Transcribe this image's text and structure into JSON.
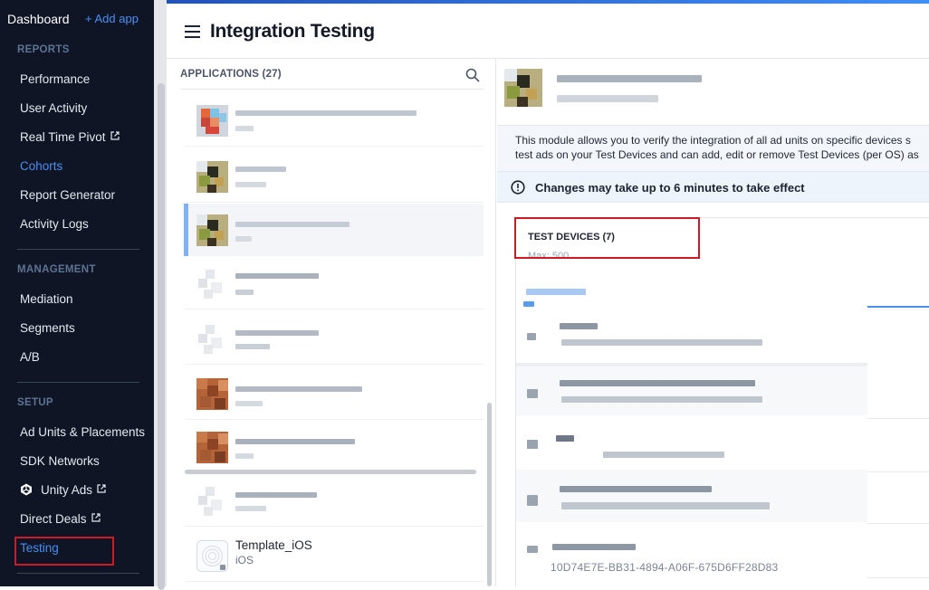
{
  "sidebar": {
    "dashboard_label": "Dashboard",
    "add_app_label": "+ Add app",
    "sections": {
      "reports": "REPORTS",
      "management": "MANAGEMENT",
      "setup": "SETUP"
    },
    "reports_items": [
      "Performance",
      "User Activity",
      "Real Time Pivot",
      "Cohorts",
      "Report Generator",
      "Activity Logs"
    ],
    "management_items": [
      "Mediation",
      "Segments",
      "A/B"
    ],
    "setup_items": [
      "Ad Units & Placements",
      "SDK Networks",
      "Unity Ads",
      "Direct Deals",
      "Testing"
    ],
    "active_item": "Cohorts",
    "selected_item": "Testing"
  },
  "header": {
    "title": "Integration Testing"
  },
  "applications": {
    "heading": "APPLICATIONS (27)",
    "last_app": {
      "name": "Template_iOS",
      "platform": "iOS"
    }
  },
  "detail": {
    "info_text": "This module allows you to verify the integration of all ad units on specific devices s test ads on your Test Devices and can add, edit or remove Test Devices (per OS) as",
    "info_line1": "This module allows you to verify the integration of all ad units on specific devices s",
    "info_line2": "test ads on your Test Devices and can add, edit or remove Test Devices (per OS) as",
    "warning": "Changes may take up to 6 minutes to take effect",
    "test_devices_title": "TEST DEVICES (7)",
    "test_devices_max": "Max: 500",
    "last_device_id": "10D74E7E-BB31-4894-A06F-675D6FF28D83"
  },
  "colors": {
    "sidebar_bg": "#0f1525",
    "accent": "#4a8ef0",
    "highlight": "#cc1b26"
  }
}
